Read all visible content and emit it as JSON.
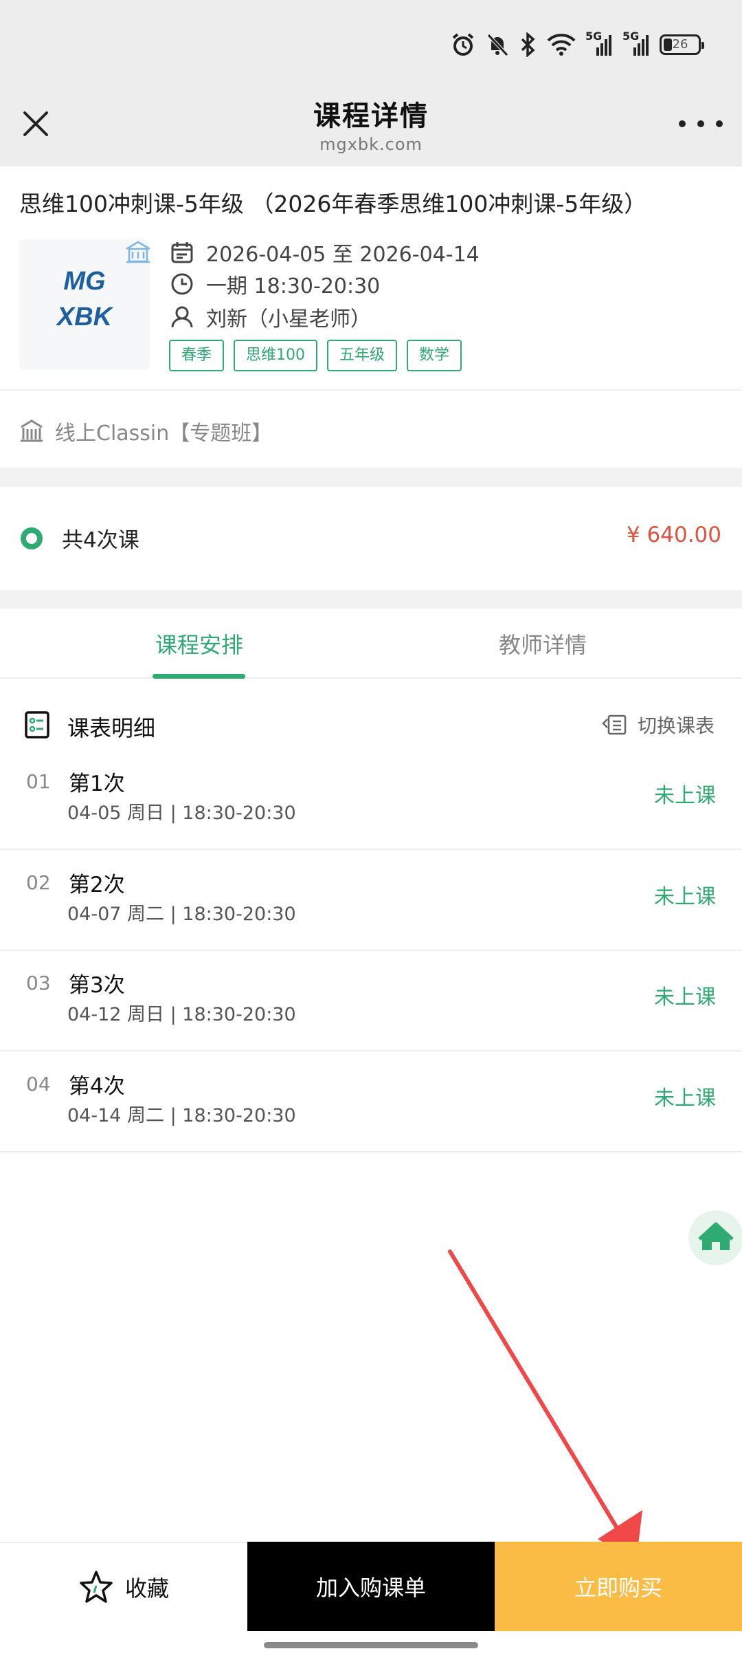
{
  "status_bar": {
    "battery_level": "26",
    "signal_1": "5G",
    "signal_2": "5G"
  },
  "header": {
    "title": "课程详情",
    "subtitle": "mgxbk.com"
  },
  "course": {
    "title": "思维100冲刺课-5年级 （2026年春季思维100冲刺课-5年级）",
    "logo_line1": "MG",
    "logo_line2": "XBK",
    "dates": "2026-04-05 至 2026-04-14",
    "session": "一期   18:30-20:30",
    "teacher": "刘新（小星老师）",
    "tags": [
      "春季",
      "思维100",
      "五年级",
      "数学"
    ],
    "location": "线上Classin【专题班】"
  },
  "pricing": {
    "label": "共4次课",
    "price": "¥ 640.00"
  },
  "tabs": [
    {
      "label": "课程安排",
      "active": true
    },
    {
      "label": "教师详情",
      "active": false
    }
  ],
  "schedule": {
    "title": "课表明细",
    "switch_label": "切换课表",
    "lessons": [
      {
        "num": "01",
        "name": "第1次",
        "time": "04-05 周日 | 18:30-20:30",
        "status": "未上课"
      },
      {
        "num": "02",
        "name": "第2次",
        "time": "04-07 周二 | 18:30-20:30",
        "status": "未上课"
      },
      {
        "num": "03",
        "name": "第3次",
        "time": "04-12 周日 | 18:30-20:30",
        "status": "未上课"
      },
      {
        "num": "04",
        "name": "第4次",
        "time": "04-14 周二 | 18:30-20:30",
        "status": "未上课"
      }
    ]
  },
  "bottom_bar": {
    "favorite_label": "收藏",
    "add_cart_label": "加入购课单",
    "buy_label": "立即购买"
  },
  "colors": {
    "accent_green": "#2eaa72",
    "price_red": "#e0533f",
    "buy_yellow": "#fbbc45",
    "annotation_arrow": "#f04848"
  },
  "icons": [
    "alarm-icon",
    "mute-bell-icon",
    "bluetooth-icon",
    "wifi-icon",
    "close-icon",
    "more-icon",
    "school-icon",
    "calendar-icon",
    "clock-icon",
    "person-icon",
    "building-icon",
    "schedule-list-icon",
    "switch-table-icon",
    "home-icon",
    "star-icon"
  ]
}
